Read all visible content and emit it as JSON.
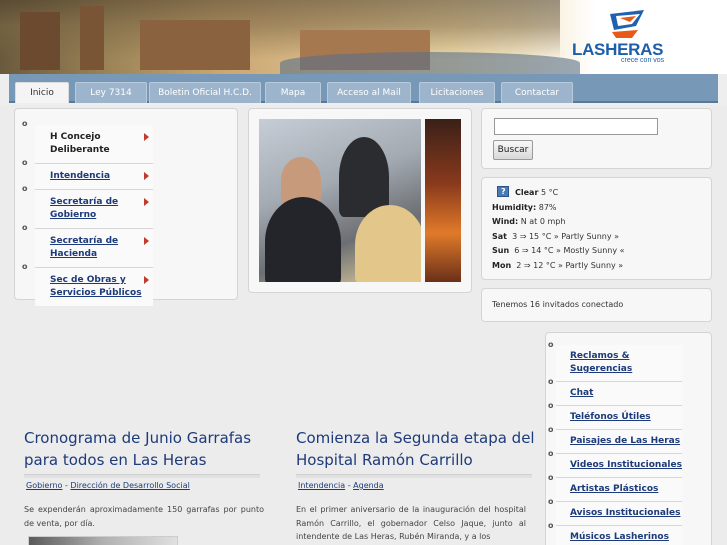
{
  "header": {
    "logo_text": "LASHERAS",
    "logo_subtitle": "crece con vos"
  },
  "nav": {
    "tabs": [
      {
        "label": "Inicio",
        "active": true
      },
      {
        "label": "Ley 7314"
      },
      {
        "label": "Boletin Oficial H.C.D."
      },
      {
        "label": "Mapa"
      },
      {
        "label": "Acceso al Mail"
      },
      {
        "label": "Licitaciones"
      },
      {
        "label": "Contactar"
      }
    ]
  },
  "left_menu": {
    "items": [
      {
        "label": "H Concejo Deliberante"
      },
      {
        "label": "Intendencia"
      },
      {
        "label": "Secretaría de Gobierno"
      },
      {
        "label": "Secretaría de Hacienda"
      },
      {
        "label": "Sec de Obras y Servicios Públicos"
      }
    ]
  },
  "search": {
    "input_value": "",
    "button_label": "Buscar"
  },
  "weather": {
    "current_condition": "Clear",
    "current_temp": "5",
    "temp_unit": "°C",
    "humidity_label": "Humidity:",
    "humidity_value": "87%",
    "wind_label": "Wind:",
    "wind_value": "N at 0 mph",
    "forecast": [
      {
        "day": "Sat",
        "low": "3",
        "high": "15",
        "desc": "Partly Sunny"
      },
      {
        "day": "Sun",
        "low": "6",
        "high": "14",
        "desc": "Mostly Sunny"
      },
      {
        "day": "Mon",
        "low": "2",
        "high": "12",
        "desc": "Partly Sunny"
      }
    ]
  },
  "visitors": {
    "text": "Tenemos 16 invitados conectado"
  },
  "right_menu": {
    "items": [
      {
        "label": "Reclamos & Sugerencias"
      },
      {
        "label": "Chat"
      },
      {
        "label": "Teléfonos Útiles"
      },
      {
        "label": "Paisajes de Las Heras"
      },
      {
        "label": "Videos Institucionales"
      },
      {
        "label": "Artistas Plásticos"
      },
      {
        "label": "Avisos Institucionales"
      },
      {
        "label": "Músicos Lasherinos"
      }
    ]
  },
  "articles": [
    {
      "title": "Cronograma de Junio Garrafas para todos en Las Heras",
      "category": "Gobierno",
      "subcategory": "Dirección de Desarrollo Social",
      "body": "Se expenderán aproximadamente 150 garrafas por punto de venta, por día."
    },
    {
      "title": "Comienza la Segunda etapa del Hospital Ramón Carrillo",
      "category": "Intendencia",
      "subcategory": "Agenda",
      "body": "En el primer aniversario de la inauguración del hospital Ramón Carrillo, el gobernador Celso Jaque, junto al intendente de Las Heras, Rubén Miranda, y a los"
    }
  ]
}
